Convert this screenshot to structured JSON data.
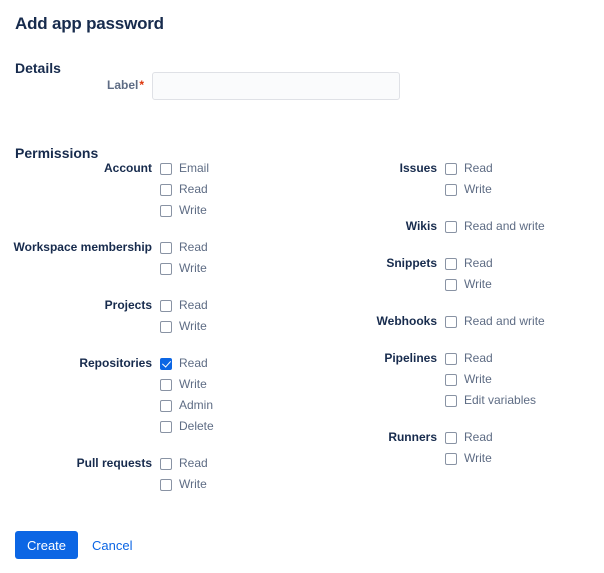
{
  "page": {
    "title": "Add app password"
  },
  "details": {
    "heading": "Details",
    "label_text": "Label",
    "required_marker": "*",
    "input_value": "",
    "input_placeholder": ""
  },
  "permissions": {
    "heading": "Permissions",
    "left_groups": [
      {
        "label": "Account",
        "options": [
          {
            "label": "Email",
            "checked": false
          },
          {
            "label": "Read",
            "checked": false
          },
          {
            "label": "Write",
            "checked": false
          }
        ]
      },
      {
        "label": "Workspace membership",
        "options": [
          {
            "label": "Read",
            "checked": false
          },
          {
            "label": "Write",
            "checked": false
          }
        ]
      },
      {
        "label": "Projects",
        "options": [
          {
            "label": "Read",
            "checked": false
          },
          {
            "label": "Write",
            "checked": false
          }
        ]
      },
      {
        "label": "Repositories",
        "options": [
          {
            "label": "Read",
            "checked": true
          },
          {
            "label": "Write",
            "checked": false
          },
          {
            "label": "Admin",
            "checked": false
          },
          {
            "label": "Delete",
            "checked": false
          }
        ]
      },
      {
        "label": "Pull requests",
        "options": [
          {
            "label": "Read",
            "checked": false
          },
          {
            "label": "Write",
            "checked": false
          }
        ]
      }
    ],
    "right_groups": [
      {
        "label": "Issues",
        "options": [
          {
            "label": "Read",
            "checked": false
          },
          {
            "label": "Write",
            "checked": false
          }
        ]
      },
      {
        "label": "Wikis",
        "options": [
          {
            "label": "Read and write",
            "checked": false
          }
        ]
      },
      {
        "label": "Snippets",
        "options": [
          {
            "label": "Read",
            "checked": false
          },
          {
            "label": "Write",
            "checked": false
          }
        ]
      },
      {
        "label": "Webhooks",
        "options": [
          {
            "label": "Read and write",
            "checked": false
          }
        ]
      },
      {
        "label": "Pipelines",
        "options": [
          {
            "label": "Read",
            "checked": false
          },
          {
            "label": "Write",
            "checked": false
          },
          {
            "label": "Edit variables",
            "checked": false
          }
        ]
      },
      {
        "label": "Runners",
        "options": [
          {
            "label": "Read",
            "checked": false
          },
          {
            "label": "Write",
            "checked": false
          }
        ]
      }
    ]
  },
  "actions": {
    "create_label": "Create",
    "cancel_label": "Cancel"
  },
  "colors": {
    "accent": "#0C66E4",
    "heading": "#172B4D",
    "muted_text": "#5E6C84",
    "required": "#DE350B",
    "input_bg": "#FAFBFC",
    "input_border": "#DFE1E6",
    "checkbox_border": "#8993A4"
  }
}
